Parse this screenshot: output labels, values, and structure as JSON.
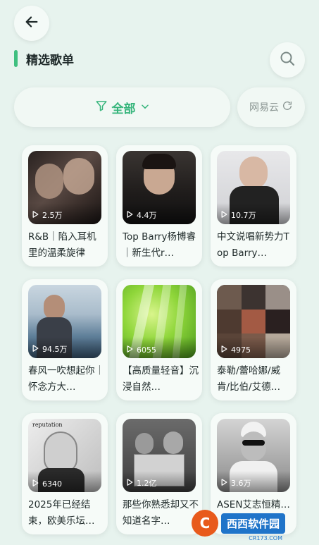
{
  "header": {
    "title": "精选歌单",
    "back_icon": "arrow-left-icon",
    "search_icon": "search-icon"
  },
  "filter": {
    "label": "全部",
    "icon": "filter-icon",
    "chevron": "chevron-down-icon",
    "source_label": "网易云",
    "source_icon": "refresh-icon"
  },
  "colors": {
    "accent": "#3fbf7f",
    "background": "#e7f3ee",
    "card": "#f6fbf8"
  },
  "playlists": [
    {
      "title": "R&B｜陷入耳机里的温柔旋律",
      "plays": "2.5万"
    },
    {
      "title": "Top Barry杨博睿｜新生代r…",
      "plays": "4.4万"
    },
    {
      "title": "中文说唱新势力Top Barry…",
      "plays": "10.7万"
    },
    {
      "title": "春风一吹想起你｜怀念方大…",
      "plays": "94.5万"
    },
    {
      "title": "【高质量轻音】沉浸自然…",
      "plays": "6055"
    },
    {
      "title": "泰勒/蕾哈娜/威肯/比伯/艾德…",
      "plays": "4975"
    },
    {
      "title": "2025年已经结束，欧美乐坛…",
      "plays": "6340"
    },
    {
      "title": "那些你熟悉却又不知道名字…",
      "plays": "1.2亿"
    },
    {
      "title": "ASEN艾志恒精…",
      "plays": "3.6万"
    }
  ],
  "watermark": {
    "logo_char": "C",
    "text": "西西软件园",
    "sub": "CR173.COM"
  }
}
